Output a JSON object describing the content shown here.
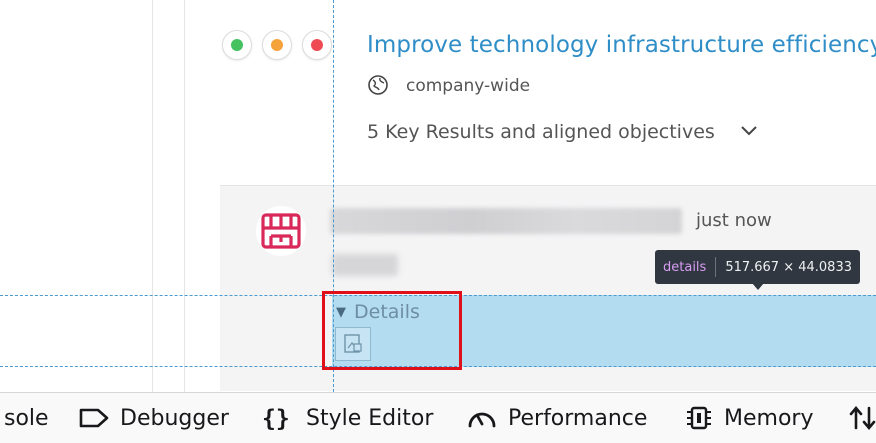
{
  "objective": {
    "status_buttons": [
      {
        "name": "green",
        "color": "#45c25f"
      },
      {
        "name": "orange",
        "color": "#f6a23a"
      },
      {
        "name": "red",
        "color": "#ef4b55"
      }
    ],
    "title": "Improve technology infrastructure efficiency",
    "scope_icon": "globe-icon",
    "scope_label": "company-wide",
    "key_results_toggle": "5 Key Results and aligned objectives"
  },
  "activity": {
    "avatar_color": "#d9285a",
    "timestamp": "just now",
    "details_label": "Details"
  },
  "inspector_tooltip": {
    "tag": "details",
    "dimensions": "517.667 × 44.0833"
  },
  "devtools": {
    "tabs": [
      {
        "label": "sole",
        "icon": "console-icon"
      },
      {
        "label": "Debugger",
        "icon": "debugger-icon"
      },
      {
        "label": "Style Editor",
        "icon": "braces-icon"
      },
      {
        "label": "Performance",
        "icon": "gauge-icon"
      },
      {
        "label": "Memory",
        "icon": "memory-chip-icon"
      },
      {
        "label": "",
        "icon": "network-arrows-icon"
      }
    ]
  },
  "colors": {
    "link": "#2f8ec7",
    "highlight": "#b3dcf0",
    "guide": "#4c9bd0",
    "annotation": "#e0101b"
  }
}
